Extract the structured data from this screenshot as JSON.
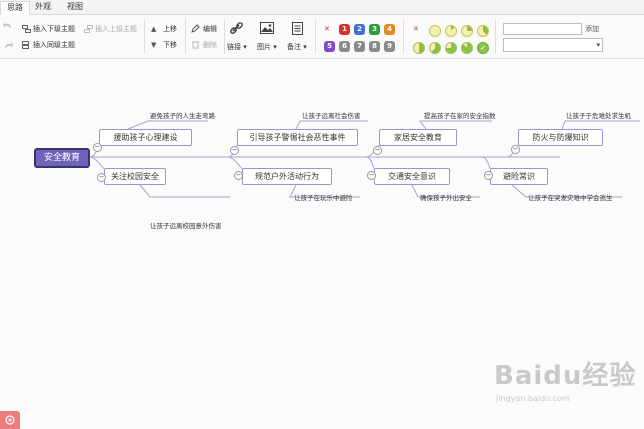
{
  "tabs": [
    "思路",
    "外观",
    "视图"
  ],
  "toolbar": {
    "insert_child": "插入下级主题",
    "insert_parent": "插入上级主题",
    "insert_sibling": "插入同级主题",
    "move_up": "上移",
    "move_down": "下移",
    "edit": "编辑",
    "delete": "删除",
    "link": "链接",
    "image": "图片",
    "note": "备注",
    "priorities": [
      "1",
      "2",
      "3",
      "4",
      "5",
      "6",
      "7",
      "8",
      "9"
    ],
    "add_label": "添加",
    "add_placeholder": ""
  },
  "colors": {
    "priority": [
      "#d8322b",
      "#3f6fd0",
      "#2e9c3a",
      "#e08b1b",
      "#7b4bc9",
      "#8a8a8a",
      "#8a8a8a",
      "#8a8a8a",
      "#8a8a8a"
    ],
    "progress": "#8bc34a",
    "node_border": "#9b95cf",
    "root_fill": "#6f64b9"
  },
  "mindmap": {
    "root": "安全教育",
    "topics": [
      {
        "label": "援助孩子心理建设",
        "leaf": "避免孩子的人生走弯路"
      },
      {
        "label": "关注校园安全",
        "leaf": "让孩子远离校园意外伤害"
      },
      {
        "label": "引导孩子警惕社会恶性事件",
        "leaf": "让孩子远离社会伤害"
      },
      {
        "label": "规范户外活动行为",
        "leaf": "让孩子在玩乐中避险"
      },
      {
        "label": "家居安全教育",
        "leaf": "提高孩子在家的安全指数"
      },
      {
        "label": "交通安全意识",
        "leaf": "确保孩子外出安全"
      },
      {
        "label": "防火与防爆知识",
        "leaf": "让孩子于危难处求生机"
      },
      {
        "label": "避险常识",
        "leaf": "让孩子在突发灾难中学会逃生"
      }
    ]
  },
  "watermark": {
    "brand": "Baidu经验",
    "url": "jingyan.baidu.com"
  }
}
